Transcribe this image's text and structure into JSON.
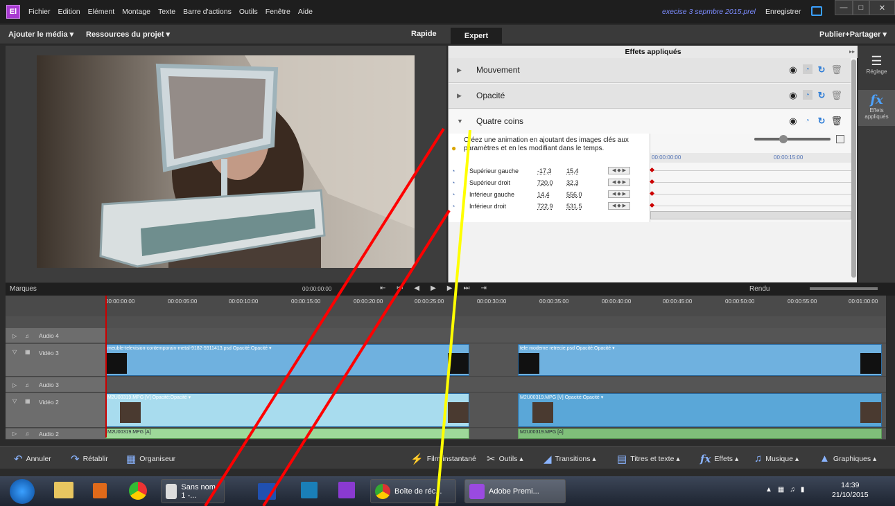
{
  "menubar": {
    "logo": "El",
    "items": [
      "Fichier",
      "Edition",
      "Elément",
      "Montage",
      "Texte",
      "Barre d'actions",
      "Outils",
      "Fenêtre",
      "Aide"
    ],
    "project": "execise 3 sepmbre 2015.prel",
    "save": "Enregistrer"
  },
  "modebar": {
    "add_media": "Ajouter le média ▾",
    "project_assets": "Ressources du projet ▾",
    "quick": "Rapide",
    "expert": "Expert",
    "publish": "Publier+Partager ▾"
  },
  "effects": {
    "title": "Effets appliqués",
    "rows": [
      {
        "name": "Mouvement"
      },
      {
        "name": "Opacité"
      },
      {
        "name": "Quatre coins"
      }
    ],
    "hint": "Créez une animation en ajoutant des images clés aux paramètres et en les modifiant dans le temps.",
    "params": [
      {
        "name": "Supérieur gauche",
        "v1": "-17,3",
        "v2": "15,4"
      },
      {
        "name": "Supérieur droit",
        "v1": "720,0",
        "v2": "32,3"
      },
      {
        "name": "Inférieur gauche",
        "v1": "14,4",
        "v2": "556,0"
      },
      {
        "name": "Inférieur droit",
        "v1": "722,9",
        "v2": "531,5"
      }
    ],
    "kf_time_start": "00:00:00:00",
    "kf_time_mid": "00:00:15:00"
  },
  "side_tabs": {
    "adjust": "Réglage",
    "applied": "Effets appliqués"
  },
  "transport": {
    "markers": "Marques",
    "timecode": "00:00:00:00",
    "render": "Rendu"
  },
  "ruler": [
    "00:00:00:00",
    "00:00:05:00",
    "00:00:10:00",
    "00:00:15:00",
    "00:00:20:00",
    "00:00:25:00",
    "00:00:30:00",
    "00:00:35:00",
    "00:00:40:00",
    "00:00:45:00",
    "00:00:50:00",
    "00:00:55:00",
    "00:01:00:00"
  ],
  "tracks": {
    "audio4": "Audio 4",
    "video3": "Vidéo 3",
    "audio3": "Audio 3",
    "video2": "Vidéo 2",
    "audio2": "Audio 2",
    "clip_v3a": "meuble-television-contemporain-metal-9182-5911413.psd  Opacité:Opacité ▾",
    "clip_v3b": "tele modeme retrecie.psd  Opacité:Opacité ▾",
    "clip_v2a": "M2U00319.MPG [V]  Opacité:Opacité ▾",
    "clip_v2b": "M2U00319.MPG [V]  Opacité:Opacité ▾",
    "clip_a2a": "M2U00319.MPG [A]",
    "clip_a2b": "M2U00319.MPG [A]"
  },
  "toolbar": {
    "undo": "Annuler",
    "redo": "Rétablir",
    "organizer": "Organiseur",
    "instant": "Film instantané",
    "tools": "Outils ▴",
    "transitions": "Transitions ▴",
    "titles": "Titres et texte ▴",
    "effects": "Effets ▴",
    "music": "Musique ▴",
    "graphics": "Graphiques ▴"
  },
  "taskbar": {
    "sans_nom": "Sans nom 1 -...",
    "chrome": "Boîte de réc...",
    "premiere": "Adobe Premi...",
    "time": "14:39",
    "date": "21/10/2015"
  }
}
